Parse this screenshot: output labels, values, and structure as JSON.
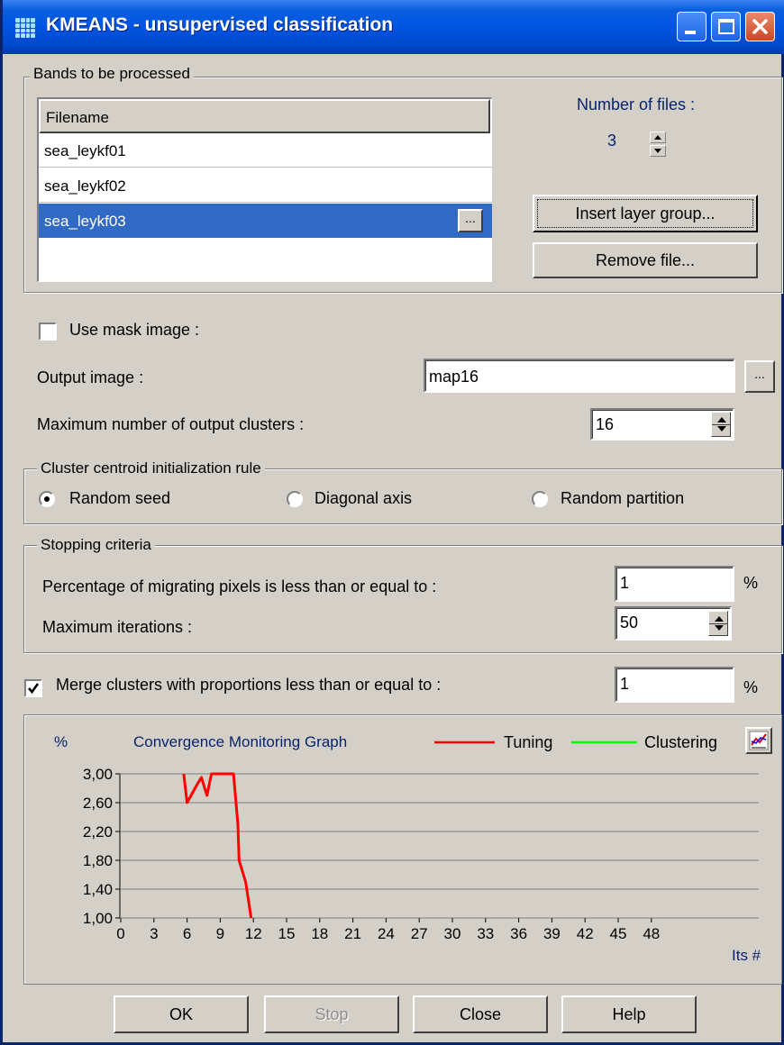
{
  "window": {
    "title": "KMEANS - unsupervised classification",
    "accent": "#0054e3",
    "controls": [
      "minimize-icon",
      "maximize-icon",
      "close-icon"
    ]
  },
  "bands": {
    "group_label": "Bands to be processed",
    "column_header": "Filename",
    "files": [
      "sea_leykf01",
      "sea_leykf02",
      "sea_leykf03"
    ],
    "selected_index": 2,
    "browse_label": "...",
    "num_files_label": "Number of files :",
    "num_files_value": "3",
    "insert_button": "Insert layer group...",
    "remove_button": "Remove file..."
  },
  "mask": {
    "label": "Use mask image :",
    "checked": false
  },
  "output": {
    "label": "Output image :",
    "value": "map16",
    "browse_label": "..."
  },
  "max_clusters": {
    "label": "Maximum number of output clusters :",
    "value": "16"
  },
  "init_rule": {
    "group_label": "Cluster centroid initialization rule",
    "options": [
      "Random seed",
      "Diagonal axis",
      "Random partition"
    ],
    "selected": "Random seed"
  },
  "stopping": {
    "group_label": "Stopping criteria",
    "pct_label": "Percentage of migrating pixels is less than or equal to :",
    "pct_value": "1",
    "pct_unit": "%",
    "iter_label": "Maximum iterations :",
    "iter_value": "50"
  },
  "merge": {
    "label": "Merge clusters with proportions less than or equal to :",
    "checked": true,
    "value": "1",
    "unit": "%"
  },
  "chart_data": {
    "type": "line",
    "title": "Convergence Monitoring Graph",
    "ylabel": "%",
    "xlabel": "Its #",
    "xlim": [
      0,
      50
    ],
    "ylim": [
      1.0,
      3.0
    ],
    "xticks": [
      "0",
      "3",
      "6",
      "9",
      "12",
      "15",
      "18",
      "21",
      "24",
      "27",
      "30",
      "33",
      "36",
      "39",
      "42",
      "45",
      "48"
    ],
    "yticks": [
      "3,00",
      "2,60",
      "2,20",
      "1,80",
      "1,40",
      "1,00"
    ],
    "grid": true,
    "legend_position": "top-right",
    "series": [
      {
        "name": "Tuning",
        "color": "#ff0000",
        "points": [
          [
            5.7,
            3.0
          ],
          [
            6.0,
            2.6
          ],
          [
            6.9,
            2.85
          ],
          [
            7.3,
            2.95
          ],
          [
            7.8,
            2.7
          ],
          [
            8.2,
            3.0
          ],
          [
            10.2,
            3.0
          ],
          [
            10.6,
            2.3
          ],
          [
            10.7,
            1.8
          ],
          [
            11.3,
            1.5
          ],
          [
            11.8,
            1.0
          ]
        ]
      },
      {
        "name": "Clustering",
        "color": "#00ff00",
        "points": []
      }
    ]
  },
  "buttons": {
    "ok": "OK",
    "stop": "Stop",
    "close": "Close",
    "help": "Help"
  }
}
